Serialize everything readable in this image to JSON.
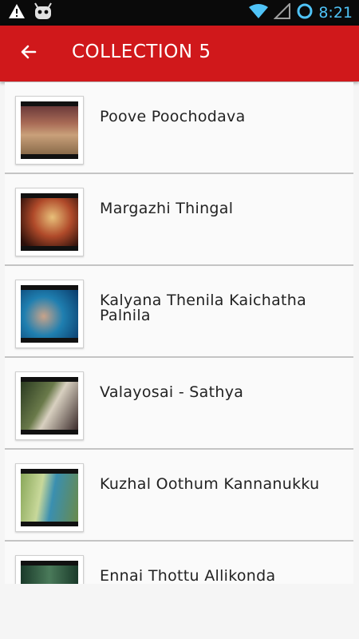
{
  "status_bar": {
    "time": "8:21",
    "icons": [
      "warning-icon",
      "android-icon",
      "wifi-icon",
      "signal-icon",
      "sync-icon"
    ]
  },
  "app_bar": {
    "title": "COLLECTION 5",
    "back_icon": "arrow-left-icon",
    "color": "#d0181b"
  },
  "songs": [
    {
      "title": "Poove Poochodava"
    },
    {
      "title": "Margazhi Thingal"
    },
    {
      "title": "Kalyana Thenila Kaichatha Palnila"
    },
    {
      "title": "Valayosai - Sathya"
    },
    {
      "title": "Kuzhal Oothum Kannanukku"
    },
    {
      "title": "Ennai Thottu Allikonda"
    }
  ]
}
